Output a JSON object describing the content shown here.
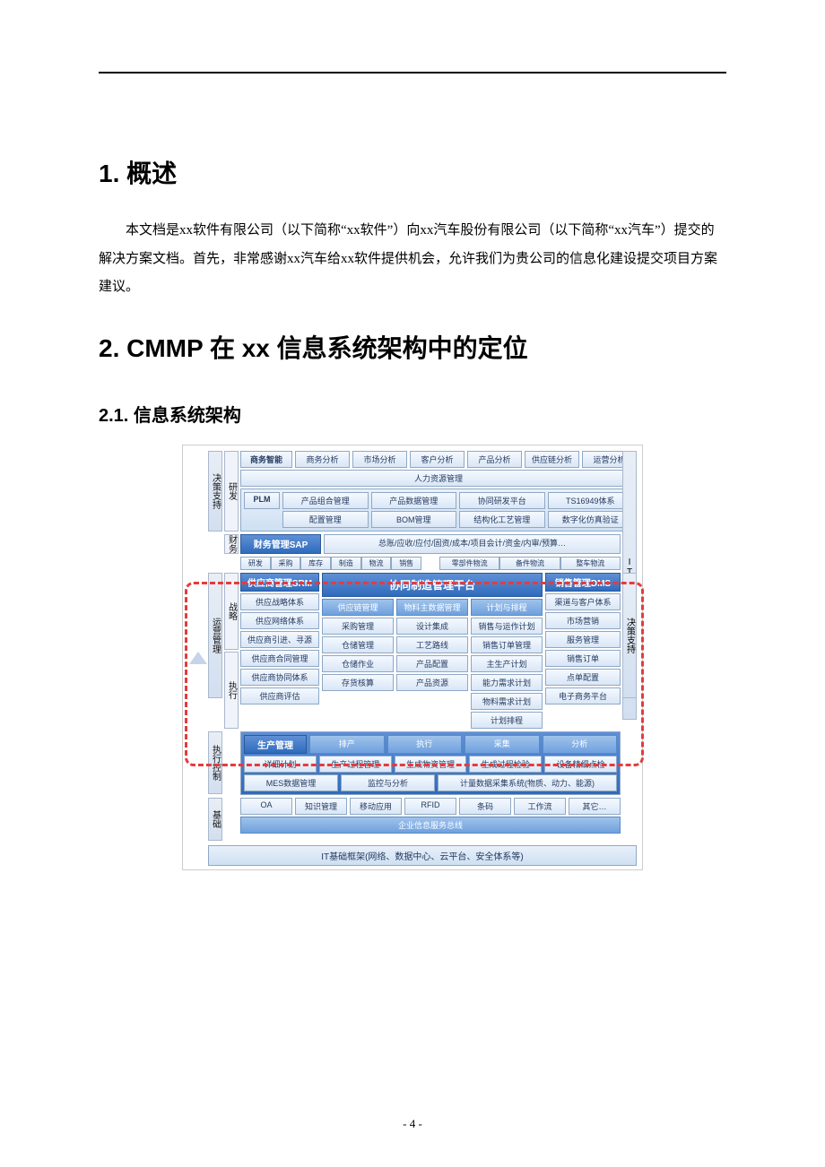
{
  "section1": {
    "num": "1.",
    "title": "概述"
  },
  "para1": "本文档是xx软件有限公司（以下简称“xx软件”）向xx汽车股份有限公司（以下简称“xx汽车”）提交的解决方案文档。首先，非常感谢xx汽车给xx软件提供机会，允许我们为贵公司的信息化建设提交项目方案建议。",
  "section2": {
    "num": "2.",
    "title": "CMMP 在 xx 信息系统架构中的定位"
  },
  "section2_1": {
    "num": "2.1.",
    "title": "信息系统架构"
  },
  "page_num": "- 4 -",
  "diagram": {
    "left_labels": [
      "决策支持",
      "运营管理",
      "执行控制",
      "基础"
    ],
    "left_labels2": [
      "研发",
      "财务",
      "战略",
      "执行"
    ],
    "right_labels": [
      "IT服务体系",
      "决策支持"
    ],
    "top_row_head": "商务智能",
    "top_row": [
      "商务分析",
      "市场分析",
      "客户分析",
      "产品分析",
      "供应链分析",
      "运营分析"
    ],
    "hr_row": "人力资源管理",
    "plm_head": "PLM",
    "plm_row1": [
      "产品组合管理",
      "产品数据管理",
      "协同研发平台",
      "TS16949体系"
    ],
    "plm_row2": [
      "配置管理",
      "BOM管理",
      "结构化工艺管理",
      "数字化仿真验证"
    ],
    "fin_head": "财务管理SAP",
    "fin_tail": "总账/应收/应付/固资/成本/项目会计/资金/内审/预算…",
    "chev1": [
      "研发",
      "采购",
      "库存",
      "制造",
      "物流",
      "销售"
    ],
    "chev1_right": [
      "零部件物流",
      "备件物流",
      "整车物流"
    ],
    "srm_head": "供应商管理SRM",
    "srm_items": [
      "供应战略体系",
      "供应网络体系",
      "供应商引进、寻源",
      "供应商合同管理",
      "供应商协同体系",
      "供应商评估"
    ],
    "cmmp_head": "协同制造管理平台",
    "scm_head": "供应链管理",
    "scm_items": [
      "采购管理",
      "仓储管理",
      "仓储作业",
      "存货核算"
    ],
    "mdm_head": "物料主数据管理",
    "mdm_items": [
      "设计集成",
      "工艺路线",
      "产品配置",
      "产品资源"
    ],
    "plan_head": "计划与排程",
    "plan_items": [
      "销售与运作计划",
      "销售订单管理",
      "主生产计划",
      "能力需求计划",
      "物料需求计划",
      "计划排程"
    ],
    "dms_head": "销售管理DMS",
    "dms_items": [
      "渠道与客户体系",
      "市场营销",
      "服务管理",
      "销售订单",
      "点单配置",
      "电子商务平台"
    ],
    "prod_head": "生产管理",
    "prod_chev": [
      "排产",
      "执行",
      "采集",
      "分析"
    ],
    "prod_row1": [
      "详细计划",
      "生产过程管理",
      "生成物资管理",
      "生成过程检验",
      "设备精细点检"
    ],
    "prod_row2": [
      "MES数据管理",
      "监控与分析",
      "计量数据采集系统(物质、动力、能源)"
    ],
    "base_row": [
      "OA",
      "知识管理",
      "移动应用",
      "RFID",
      "条码",
      "工作流",
      "其它…"
    ],
    "base_bus": "企业信息服务总线",
    "base_infra": "IT基础框架(网络、数据中心、云平台、安全体系等)"
  }
}
